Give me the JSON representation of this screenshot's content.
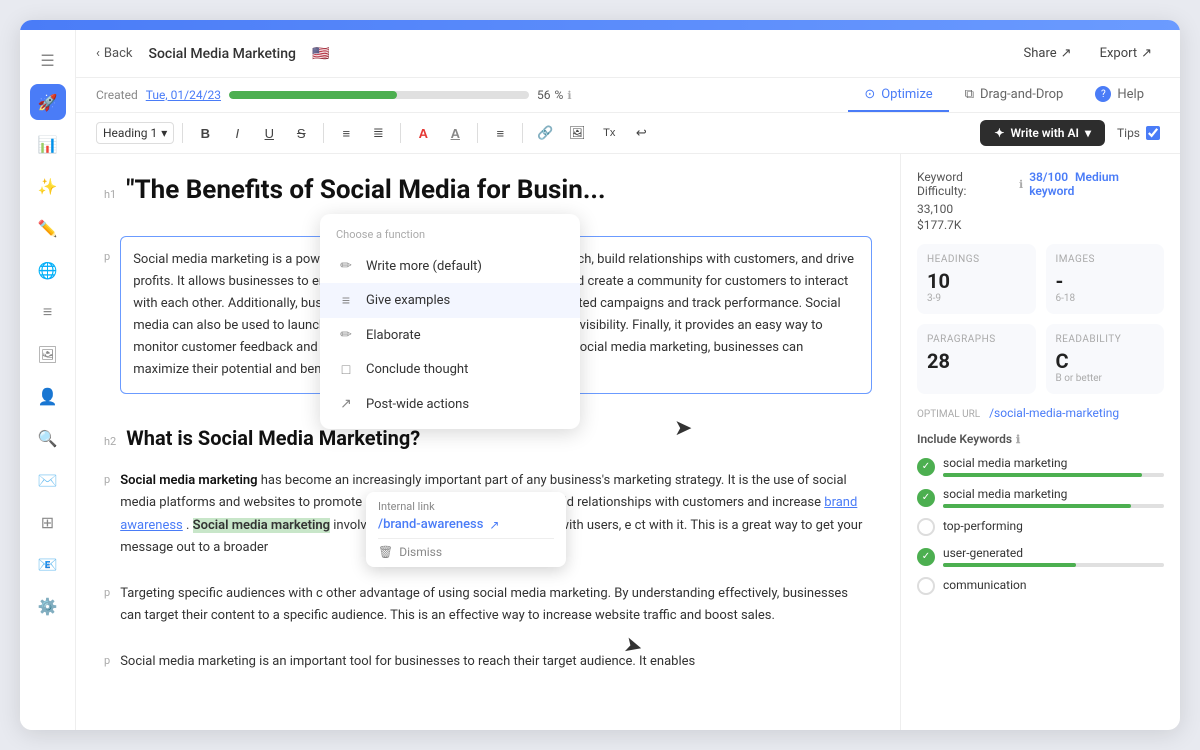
{
  "topbar": {
    "color": "#4a7cf7"
  },
  "sidebar": {
    "icons": [
      {
        "name": "menu-icon",
        "symbol": "☰",
        "active": false
      },
      {
        "name": "rocket-icon",
        "symbol": "🚀",
        "active": true
      },
      {
        "name": "chart-icon",
        "symbol": "📊",
        "active": false
      },
      {
        "name": "magic-icon",
        "symbol": "✨",
        "active": false
      },
      {
        "name": "edit-icon",
        "symbol": "✏️",
        "active": false
      },
      {
        "name": "globe-icon",
        "symbol": "🌐",
        "active": false
      },
      {
        "name": "list-icon",
        "symbol": "📋",
        "active": false
      },
      {
        "name": "image-icon",
        "symbol": "🖼",
        "active": false
      },
      {
        "name": "person-icon",
        "symbol": "👤",
        "active": false
      },
      {
        "name": "search-icon",
        "symbol": "🔍",
        "active": false
      },
      {
        "name": "mail-icon",
        "symbol": "✉️",
        "active": false
      },
      {
        "name": "grid-icon",
        "symbol": "⊞",
        "active": false
      },
      {
        "name": "envelope-icon",
        "symbol": "📧",
        "active": false
      },
      {
        "name": "settings-icon",
        "symbol": "⚙️",
        "active": false
      }
    ]
  },
  "header": {
    "back_label": "Back",
    "doc_title": "Social Media Marketing",
    "doc_flag": "🇺🇸",
    "share_label": "Share",
    "export_label": "Export"
  },
  "progress_row": {
    "created_label": "Created",
    "created_date": "Tue, 01/24/23",
    "progress_pct": 56,
    "progress_info": "ℹ"
  },
  "tabs": [
    {
      "label": "Optimize",
      "icon": "⊙",
      "active": true
    },
    {
      "label": "Drag-and-Drop",
      "icon": "⧉",
      "active": false
    },
    {
      "label": "Help",
      "icon": "?",
      "active": false
    }
  ],
  "toolbar": {
    "heading_select": "Heading 1",
    "heading_arrow": "▾",
    "bold": "B",
    "italic": "I",
    "underline": "U",
    "strikethrough": "S",
    "ordered_list": "≡",
    "unordered_list": "≡",
    "font_color": "A",
    "font_bg": "A",
    "align": "≡",
    "link": "🔗",
    "image": "🖼",
    "clear": "Tx",
    "undo": "↩",
    "write_ai_label": "Write with AI",
    "write_ai_icon": "✦",
    "tips_label": "Tips",
    "tips_checked": true
  },
  "ai_dropdown": {
    "title": "Choose a function",
    "items": [
      {
        "icon": "✏️",
        "label": "Write more (default)",
        "selected": false
      },
      {
        "icon": "≡",
        "label": "Give examples",
        "selected": true
      },
      {
        "icon": "✏️",
        "label": "Elaborate",
        "selected": false
      },
      {
        "icon": "□",
        "label": "Conclude thought",
        "selected": false
      },
      {
        "icon": "↗",
        "label": "Post-wide actions",
        "selected": false
      }
    ]
  },
  "editor": {
    "h1_tag": "h1",
    "h1_text": "\"The Benefits of Social Media for Busin",
    "paragraph_text": "Social media marketing is a powerful tool for businesses to increase their reach, build relationships with customers, and drive profits. It allows businesses to engage with customers, build brand loyalty, and create a community for customers to interact with each other. Additionally, businesses can use social media to create targeted campaigns and track performance. Social media can also be used to launch new products, promote deals, and increase visibility. Finally, it provides an easy way to monitor customer feedback and respond quickly to customer inquiries. With social media marketing, businesses can maximize their potential and benefit from the powerful advantages it offers.",
    "h2_tag": "h2",
    "h2_text": "What is Social Media Marketing?",
    "p1_tag": "p",
    "p1_text_before": "Social media marketing",
    "p1_text_main": " has become an increasingly important part of any business's marketing strategy. It is the use of social media platforms and websites to promote a product or service, as well as build relationships with customers and increase ",
    "p1_link": "brand awareness",
    "p1_text_after": ". ",
    "p1_text_cont": "Social media marketing",
    "p1_text_end": " involves creating content that engages with users, e",
    "p1_truncated": "ct with it. This is a great way to get your message out to a broader",
    "p2_tag": "p",
    "p2_text": "Targeting specific audiences with c",
    "p2_truncated": "other advantage of using social media marketing. By understanding",
    "p2_cont": "effectively, businesses can target their content to a specific audience. This is an effective way to increase website traffic and boost sales.",
    "p3_tag": "p",
    "p3_text": "Social media marketing is an important tool for businesses to reach their target audience. It enables"
  },
  "internal_link_tooltip": {
    "label": "Internal link",
    "url": "/brand-awareness",
    "dismiss_label": "Dismiss"
  },
  "right_panel": {
    "kw_difficulty_label": "Keyword Difficulty:",
    "kw_score": "38/100",
    "kw_level": "Medium keyword",
    "kw_volume": "33,100",
    "kw_value": "$177.7K",
    "metrics": [
      {
        "label": "HEADINGS",
        "value": "10",
        "range": "3-9"
      },
      {
        "label": "IMAGES",
        "value": "-",
        "range": "6-18"
      },
      {
        "label": "PARAGRAPHS",
        "value": "28",
        "range": ""
      },
      {
        "label": "READABILITY",
        "value": "C",
        "range": "B or better"
      }
    ],
    "optimal_url_label": "OPTIMAL URL",
    "optimal_url": "/social-media-marketing",
    "include_kw_label": "Include Keywords",
    "keywords": [
      {
        "text": "social media marketing",
        "filled": true,
        "bar": 90
      },
      {
        "text": "social media marketing",
        "filled": true,
        "bar": 85
      },
      {
        "text": "top-performing",
        "filled": false,
        "bar": 0
      },
      {
        "text": "user-generated",
        "filled": true,
        "bar": 60
      },
      {
        "text": "communication",
        "filled": false,
        "bar": 0
      }
    ]
  }
}
